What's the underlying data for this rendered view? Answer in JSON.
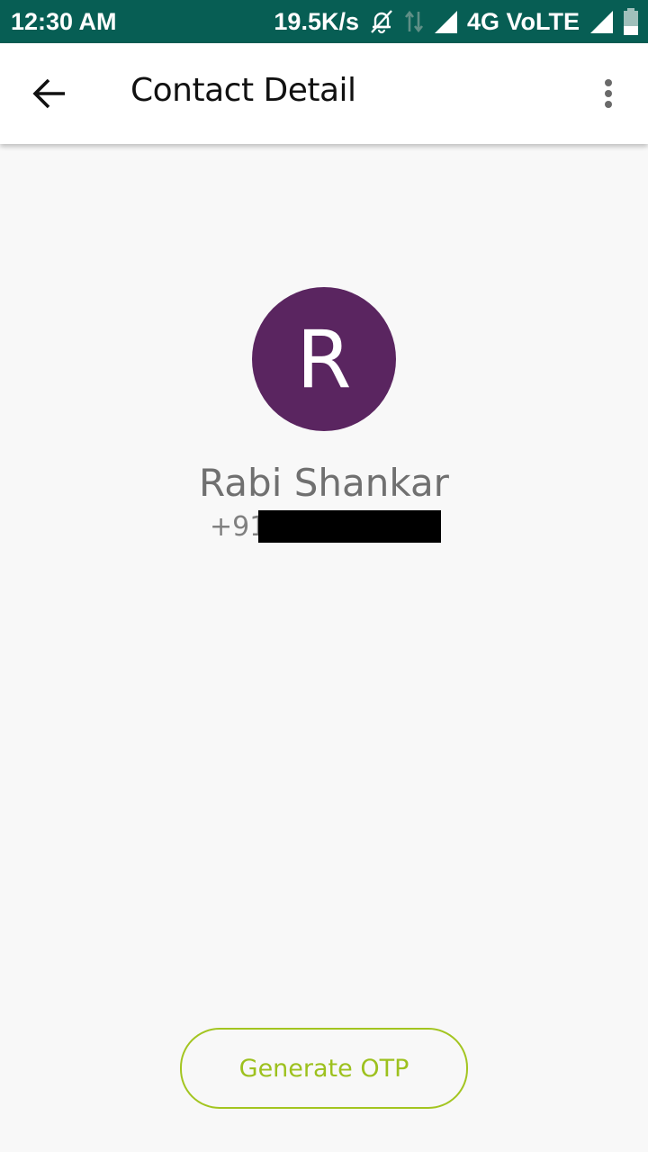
{
  "status_bar": {
    "time": "12:30 AM",
    "net_speed": "19.5K/s",
    "network_label": "4G VoLTE",
    "icons": [
      "notifications-off-icon",
      "data-arrows-icon",
      "signal-icon",
      "signal-icon",
      "battery-icon"
    ]
  },
  "app_bar": {
    "title": "Contact Detail",
    "back_icon": "arrow-back-icon",
    "menu_icon": "more-vert-icon"
  },
  "contact": {
    "initial": "R",
    "name": "Rabi Shankar",
    "phone_visible": "+918",
    "avatar_color": "#5a2560"
  },
  "actions": {
    "generate_otp_label": "Generate OTP",
    "accent_color": "#9dc11e"
  },
  "colors": {
    "status_bar": "#075e54",
    "background": "#f8f8f8"
  }
}
